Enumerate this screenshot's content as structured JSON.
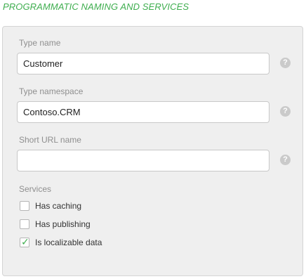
{
  "section_title": "PROGRAMMATIC NAMING AND SERVICES",
  "fields": {
    "type_name": {
      "label": "Type name",
      "value": "Customer",
      "placeholder": ""
    },
    "type_namespace": {
      "label": "Type namespace",
      "value": "Contoso.CRM",
      "placeholder": ""
    },
    "short_url_name": {
      "label": "Short URL name",
      "value": "",
      "placeholder": ""
    }
  },
  "help_icon_glyph": "?",
  "services": {
    "label": "Services",
    "options": [
      {
        "label": "Has caching",
        "checked": false
      },
      {
        "label": "Has publishing",
        "checked": false
      },
      {
        "label": "Is localizable data",
        "checked": true
      }
    ],
    "check_glyph": "✓"
  },
  "colors": {
    "accent_green": "#3fae4f",
    "panel_bg": "#efefef",
    "label_gray": "#8f8f8f"
  }
}
